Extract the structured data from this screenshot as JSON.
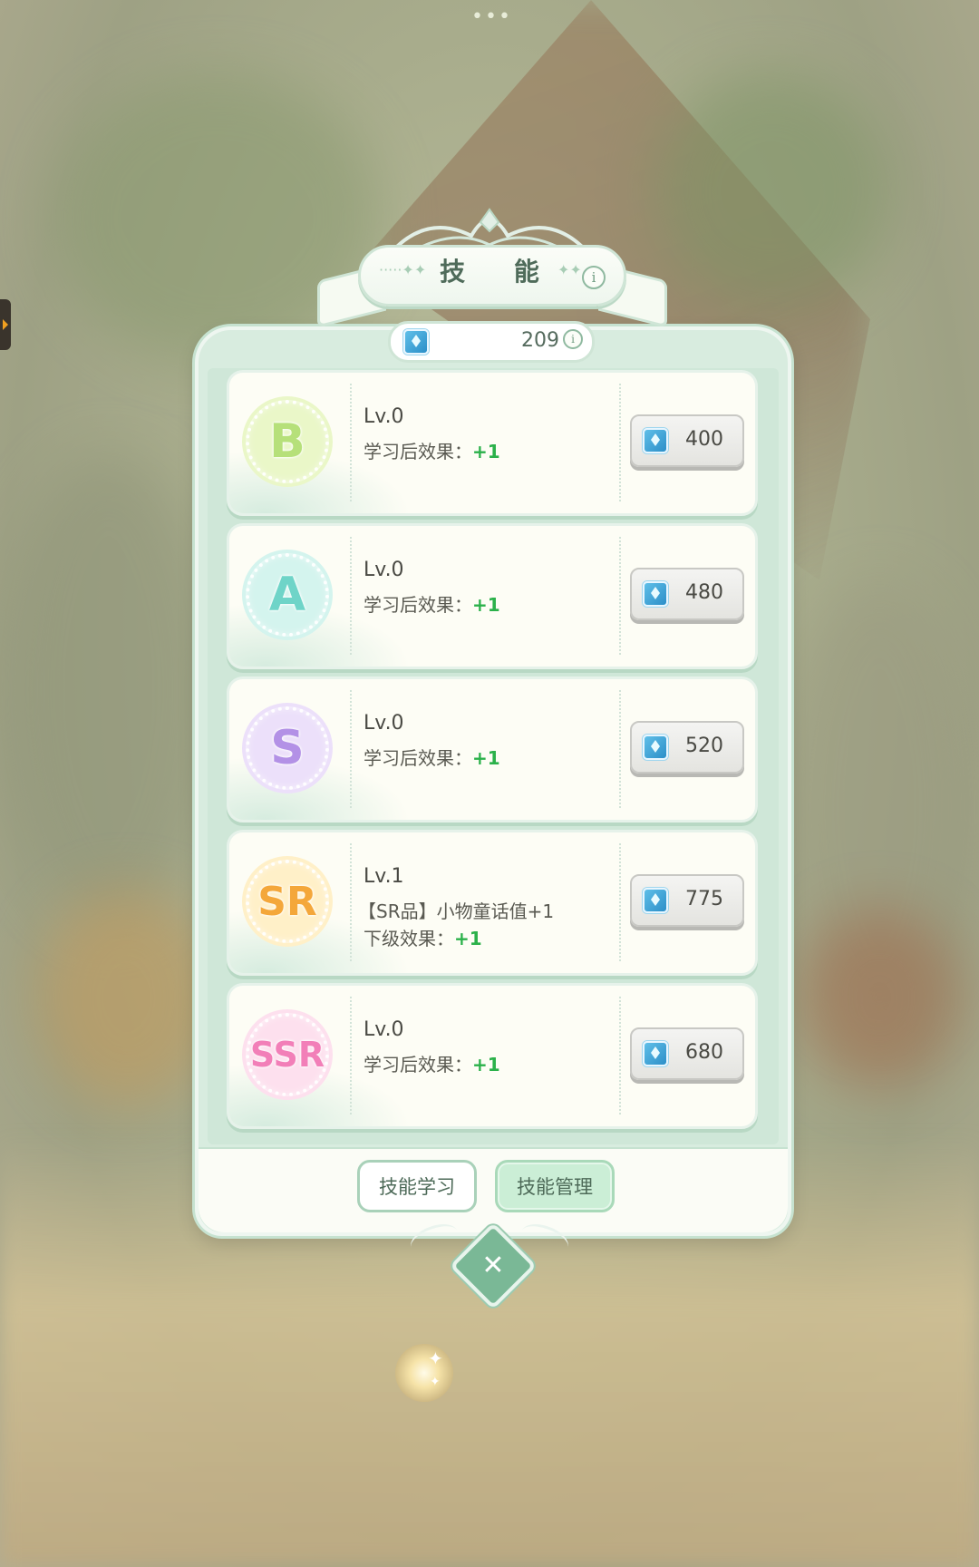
{
  "dialog": {
    "title": "技 能",
    "currency": {
      "icon": "gem-icon",
      "value": "209"
    }
  },
  "skills": [
    {
      "grade": "B",
      "color": "#b6e07a",
      "bg": "#eaf7c8",
      "level": "Lv.0",
      "effect_label": "学习后效果：",
      "effect_value": "+1",
      "price": "400"
    },
    {
      "grade": "A",
      "color": "#6fd4c8",
      "bg": "#d4f4ee",
      "level": "Lv.0",
      "effect_label": "学习后效果：",
      "effect_value": "+1",
      "price": "480"
    },
    {
      "grade": "S",
      "color": "#b391e6",
      "bg": "#ece0fa",
      "level": "Lv.0",
      "effect_label": "学习后效果：",
      "effect_value": "+1",
      "price": "520"
    },
    {
      "grade": "SR",
      "color": "#f4a73a",
      "bg": "#fff0c8",
      "level": "Lv.1",
      "effect_desc": "【SR品】小物童话值+1",
      "effect_label": "下级效果：",
      "effect_value": "+1",
      "price": "775"
    },
    {
      "grade": "SSR",
      "color": "#f27fb8",
      "bg": "#fde0ee",
      "level": "Lv.0",
      "effect_label": "学习后效果：",
      "effect_value": "+1",
      "price": "680"
    }
  ],
  "footer": {
    "learn_label": "技能学习",
    "manage_label": "技能管理"
  },
  "colors": {
    "panel": "#d8ecdf",
    "accent_green": "#2bb14a"
  }
}
